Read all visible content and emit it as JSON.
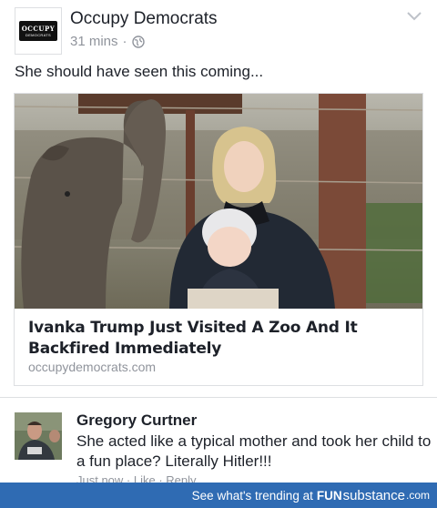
{
  "post": {
    "page_name": "Occupy Democrats",
    "timestamp": "31 mins",
    "separator": "·",
    "privacy_icon": "globe-icon",
    "menu_icon": "chevron-down-icon",
    "avatar_logo": {
      "line1": "OCCUPY",
      "line2": "DEMOCRATS"
    },
    "text": "She should have seen this coming..."
  },
  "link_preview": {
    "title": "Ivanka Trump Just Visited A Zoo And It Backfired Immediately",
    "domain": "occupydemocrats.com"
  },
  "comment": {
    "author": "Gregory Curtner",
    "text": "She acted like a typical mother and took her child to a fun place? Literally Hitler!!!",
    "actions": "Just now · Like · Reply"
  },
  "banner": {
    "prefix": "See what's trending at",
    "brand_bold": "FUN",
    "brand_regular": "substance",
    "brand_suffix": ".com"
  },
  "colors": {
    "text_primary": "#1d2129",
    "text_secondary": "#90949c",
    "border": "#dddfe2",
    "banner_bg": "#2f6bb3"
  }
}
